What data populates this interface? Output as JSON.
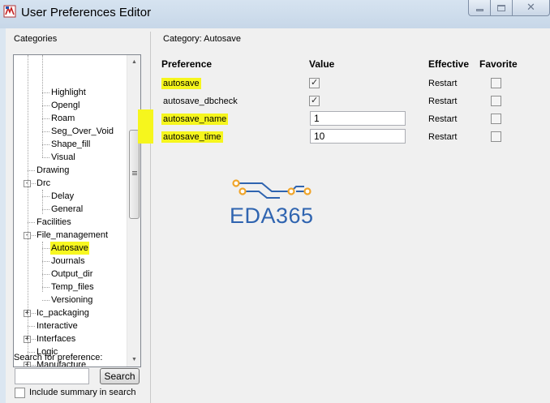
{
  "window": {
    "title": "User Preferences Editor"
  },
  "categories": {
    "label": "Categories",
    "tree": [
      {
        "label": "Highlight",
        "depth": 2
      },
      {
        "label": "Opengl",
        "depth": 2
      },
      {
        "label": "Roam",
        "depth": 2
      },
      {
        "label": "Seg_Over_Void",
        "depth": 2
      },
      {
        "label": "Shape_fill",
        "depth": 2
      },
      {
        "label": "Visual",
        "depth": 2
      },
      {
        "label": "Drawing",
        "depth": 1
      },
      {
        "label": "Drc",
        "depth": 1,
        "expander": "-"
      },
      {
        "label": "Delay",
        "depth": 2
      },
      {
        "label": "General",
        "depth": 2
      },
      {
        "label": "Facilities",
        "depth": 1
      },
      {
        "label": "File_management",
        "depth": 1,
        "expander": "-"
      },
      {
        "label": "Autosave",
        "depth": 2,
        "selected": true
      },
      {
        "label": "Journals",
        "depth": 2
      },
      {
        "label": "Output_dir",
        "depth": 2
      },
      {
        "label": "Temp_files",
        "depth": 2
      },
      {
        "label": "Versioning",
        "depth": 2
      },
      {
        "label": "Ic_packaging",
        "depth": 1,
        "expander": "+"
      },
      {
        "label": "Interactive",
        "depth": 1
      },
      {
        "label": "Interfaces",
        "depth": 1,
        "expander": "+"
      },
      {
        "label": "Logic",
        "depth": 1
      },
      {
        "label": "Manufacture",
        "depth": 1,
        "expander": "+"
      }
    ]
  },
  "search": {
    "label": "Search for preference:",
    "value": "",
    "button": "Search",
    "include_summary": "Include summary in search",
    "include_summary_checked": false
  },
  "category_header": "Category:  Autosave",
  "columns": {
    "preference": "Preference",
    "value": "Value",
    "effective": "Effective",
    "favorite": "Favorite"
  },
  "preferences": [
    {
      "name": "autosave",
      "type": "check",
      "checked": true,
      "effective": "Restart",
      "favorite": false
    },
    {
      "name": "autosave_dbcheck",
      "type": "check",
      "checked": true,
      "effective": "Restart",
      "favorite": false
    },
    {
      "name": "autosave_name",
      "type": "text",
      "value": "1",
      "effective": "Restart",
      "favorite": false
    },
    {
      "name": "autosave_time",
      "type": "text",
      "value": "10",
      "effective": "Restart",
      "favorite": false
    }
  ],
  "logo": {
    "text": "EDA365"
  },
  "colors": {
    "highlight": "#f6f61d",
    "logo_blue": "#2f64b0",
    "logo_orange": "#f0a52a"
  }
}
